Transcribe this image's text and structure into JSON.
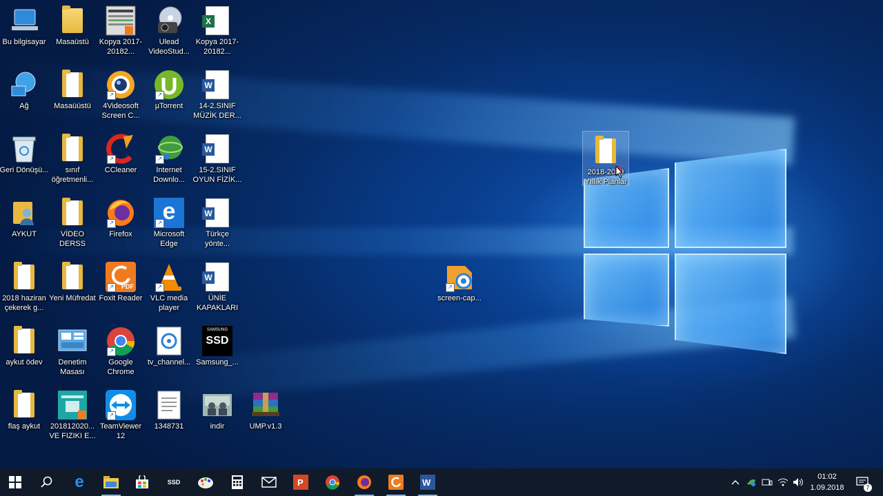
{
  "desktop_icons": [
    {
      "label": "Bu bilgisayar"
    },
    {
      "label": "Masaüstü"
    },
    {
      "label": "Kopya 2017-20182..."
    },
    {
      "label": "Ulead VideoStud..."
    },
    {
      "label": "Kopya 2017-20182..."
    },
    {
      "label": "Ağ"
    },
    {
      "label": "Masaüüstü"
    },
    {
      "label": "4Videosoft Screen C..."
    },
    {
      "label": "µTorrent"
    },
    {
      "label": "14-2.SINIF MÜZİK DER..."
    },
    {
      "label": "Geri Dönüşü..."
    },
    {
      "label": "sınıf öğretmenli..."
    },
    {
      "label": "CCleaner"
    },
    {
      "label": "Internet Downlo..."
    },
    {
      "label": "15-2.SINIF OYUN FİZİK..."
    },
    {
      "label": "AYKUT"
    },
    {
      "label": "VİDEO DERSS"
    },
    {
      "label": "Firefox"
    },
    {
      "label": "Microsoft Edge"
    },
    {
      "label": "Türkçe yönte..."
    },
    {
      "label": "2018 haziran çekerek g..."
    },
    {
      "label": "Yeni Müfredat"
    },
    {
      "label": "Foxit Reader"
    },
    {
      "label": "VLC media player"
    },
    {
      "label": "ÜNİE KAPAKLARI"
    },
    {
      "label": "aykut ödev"
    },
    {
      "label": "Denetim Masası"
    },
    {
      "label": "Google Chrome"
    },
    {
      "label": "tv_channel..."
    },
    {
      "label": "Samsung_..."
    },
    {
      "label": "flaş aykut"
    },
    {
      "label": "201812020... VE FIZIKI E..."
    },
    {
      "label": "TeamViewer 12"
    },
    {
      "label": "1348731"
    },
    {
      "label": "indir"
    },
    {
      "label": "UMP.v1.3"
    },
    {
      "label": "2018-2019 Yıllık Planlar"
    },
    {
      "label": "screen-cap..."
    }
  ],
  "icon_texts": {
    "word": "W",
    "excel": "X",
    "ssd_brand": "SAMSUNG",
    "ssd": "SSD",
    "pdf": "PDF",
    "edge": "e"
  },
  "taskbar": {
    "ssd_label": "SSD",
    "clock_time": "01:02",
    "clock_date": "1.09.2018",
    "notification_count": "7"
  },
  "colors": {
    "accent": "#76b9ed",
    "taskbar_bg": "#101a28"
  }
}
